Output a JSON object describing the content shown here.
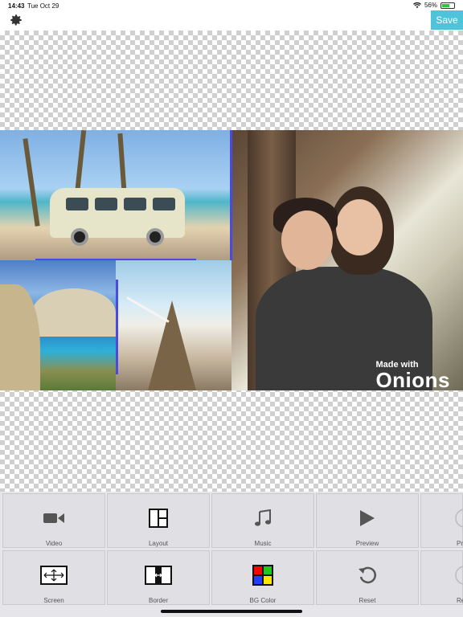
{
  "status_bar": {
    "time": "14:43",
    "date": "Tue Oct 29",
    "battery": "56%",
    "battery_level": 0.56
  },
  "header": {
    "settings_icon": "gear-icon",
    "save_label": "Save",
    "save_color": "#4fc3d9"
  },
  "collage": {
    "photos": [
      "beach-van-photo",
      "cliff-beach-photo",
      "pier-photo",
      "couple-photo"
    ],
    "watermark": {
      "line1": "Made with",
      "line2": "Onions"
    }
  },
  "toolbar": {
    "row1": [
      {
        "label": "Video",
        "icon": "video-camera-icon"
      },
      {
        "label": "Layout",
        "icon": "layout-grid-icon"
      },
      {
        "label": "Music",
        "icon": "music-note-icon"
      },
      {
        "label": "Preview",
        "icon": "play-icon"
      },
      {
        "label": "Pr",
        "icon": "circle-icon"
      }
    ],
    "row2": [
      {
        "label": "Screen",
        "icon": "screen-expand-icon"
      },
      {
        "label": "Border",
        "icon": "border-resize-icon"
      },
      {
        "label": "BG Color",
        "icon": "color-grid-icon"
      },
      {
        "label": "Reset",
        "icon": "reset-arrow-icon"
      },
      {
        "label": "Re",
        "icon": "circle-icon"
      }
    ]
  }
}
